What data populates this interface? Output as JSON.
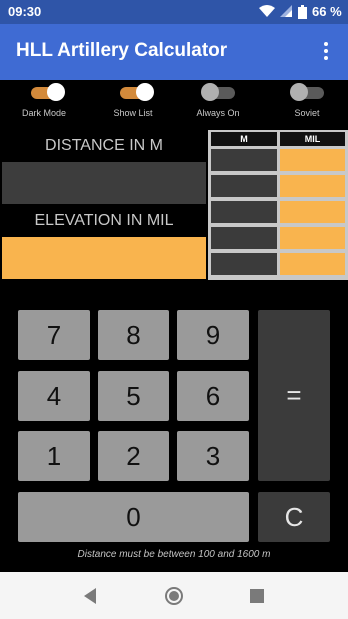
{
  "status_bar": {
    "time": "09:30",
    "battery_percent": "66 %",
    "icons": [
      "wifi-icon",
      "signal-icon",
      "battery-icon"
    ]
  },
  "app_bar": {
    "title": "HLL Artillery Calculator",
    "menu_icon": "more-vert-icon"
  },
  "toggles": [
    {
      "label": "Dark Mode",
      "checked": true
    },
    {
      "label": "Show List",
      "checked": true
    },
    {
      "label": "Always On",
      "checked": false
    },
    {
      "label": "Soviet",
      "checked": false
    }
  ],
  "inputs": {
    "distance_label": "DISTANCE IN M",
    "distance_value": "",
    "elevation_label": "ELEVATION IN MIL",
    "elevation_value": ""
  },
  "list_table": {
    "headers": [
      "M",
      "MIL"
    ],
    "rows": [
      [
        "",
        ""
      ],
      [
        "",
        ""
      ],
      [
        "",
        ""
      ],
      [
        "",
        ""
      ],
      [
        "",
        ""
      ]
    ]
  },
  "keypad": {
    "k7": "7",
    "k8": "8",
    "k9": "9",
    "k4": "4",
    "k5": "5",
    "k6": "6",
    "k1": "1",
    "k2": "2",
    "k3": "3",
    "k0": "0",
    "equals": "=",
    "clear": "C"
  },
  "hint": "Distance must be between 100 and 1600 m",
  "nav_bar": {
    "icons": [
      "back-icon",
      "home-icon",
      "recents-icon"
    ]
  },
  "colors": {
    "status_bar": "#2f55a8",
    "app_bar": "#3f6bd3",
    "accent": "#f9b44e",
    "dark_field": "#3d3d3d",
    "key": "#9a9a9a"
  }
}
